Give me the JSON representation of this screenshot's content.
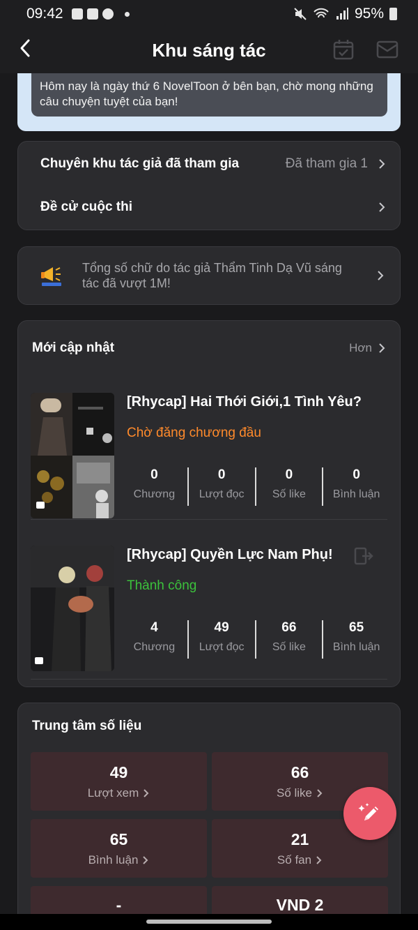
{
  "statusbar": {
    "time": "09:42",
    "battery": "95%"
  },
  "header": {
    "title": "Khu sáng tác"
  },
  "banner": {
    "text": "Hôm nay là ngày thứ 6 NovelToon ở bên bạn, chờ mong những câu chuyện tuyệt của bạn!"
  },
  "menu": {
    "joined_label": "Chuyên khu tác giả đã tham gia",
    "joined_value": "Đã tham gia 1",
    "contest_label": "Đề cử cuộc thi"
  },
  "notice": {
    "text": "Tổng số chữ do tác giả Thẩm Tinh Dạ Vũ sáng tác đã vượt 1M!"
  },
  "updates": {
    "title": "Mới cập nhật",
    "more": "Hơn",
    "books": [
      {
        "title": "[Rhycap] Hai Thới Giới,1 Tình Yêu?",
        "status": "Chờ đăng chương đầu",
        "status_color": "#ff8a2b",
        "stats": [
          {
            "n": "0",
            "l": "Chương"
          },
          {
            "n": "0",
            "l": "Lượt đọc"
          },
          {
            "n": "0",
            "l": "Số like"
          },
          {
            "n": "0",
            "l": "Bình luận"
          }
        ]
      },
      {
        "title": "[Rhycap] Quyền Lực Nam Phụ!",
        "status": "Thành công",
        "status_color": "#3cc23c",
        "stats": [
          {
            "n": "4",
            "l": "Chương"
          },
          {
            "n": "49",
            "l": "Lượt đọc"
          },
          {
            "n": "66",
            "l": "Số like"
          },
          {
            "n": "65",
            "l": "Bình luận"
          }
        ]
      }
    ]
  },
  "data_center": {
    "title": "Trung tâm số liệu",
    "metrics": [
      {
        "n": "49",
        "l": "Lượt xem"
      },
      {
        "n": "66",
        "l": "Số like"
      },
      {
        "n": "65",
        "l": "Bình luận"
      },
      {
        "n": "21",
        "l": "Số fan"
      },
      {
        "n": "-",
        "l": ""
      },
      {
        "n": "VND 2",
        "l": ""
      }
    ]
  },
  "colors": {
    "accent": "#ec5a6b",
    "background": "#1a1a1c",
    "card": "#2b2b2e",
    "metric": "#3e2a2e"
  }
}
